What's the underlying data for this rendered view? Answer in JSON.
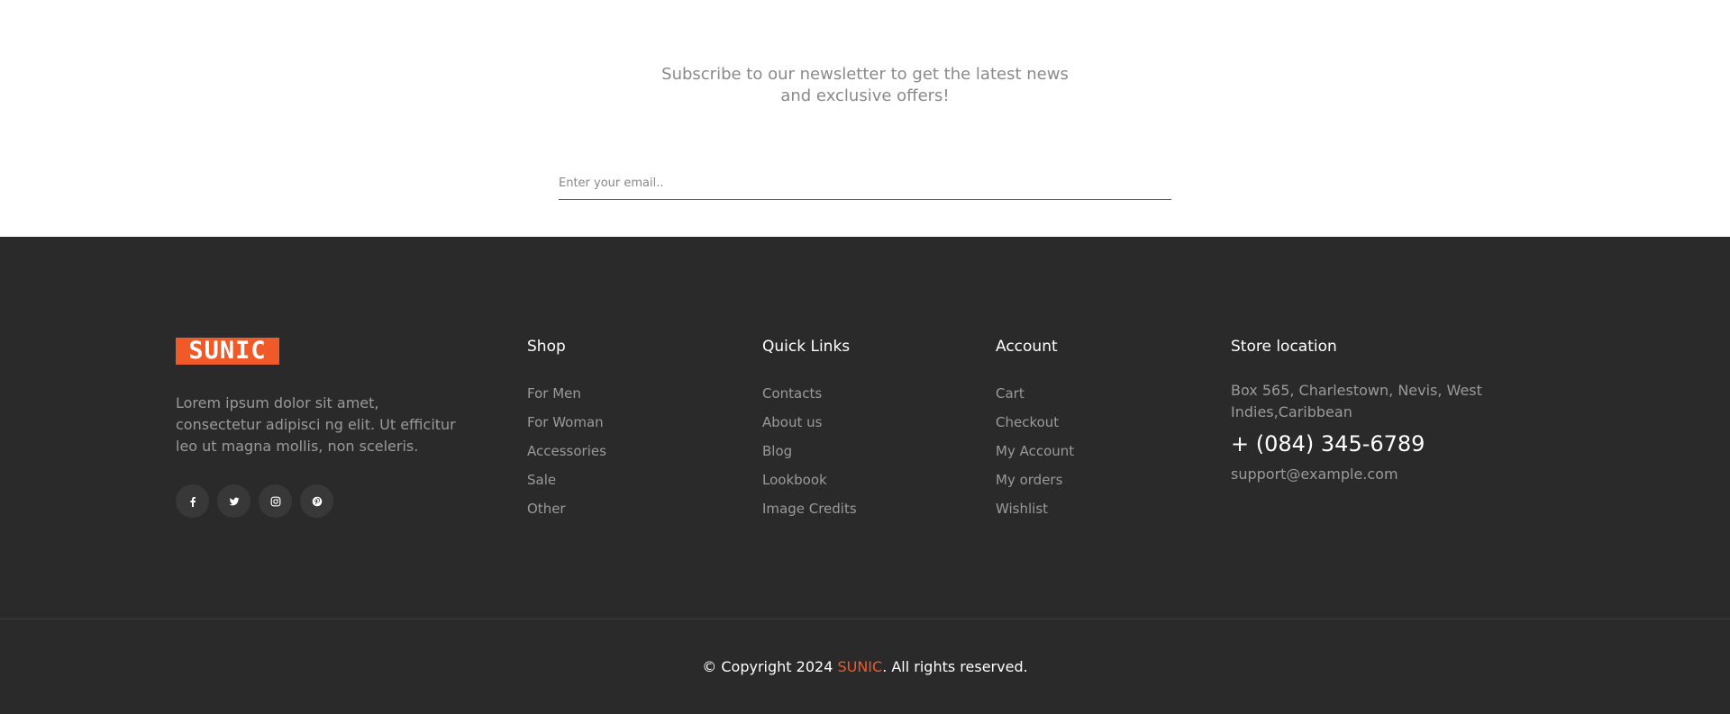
{
  "newsletter": {
    "line1": "Subscribe to our newsletter to get the latest news",
    "line2": "and exclusive offers!",
    "email_placeholder": "Enter your email.."
  },
  "footer": {
    "logo_text": "SUNIC",
    "about": "Lorem ipsum dolor sit amet, consectetur adipisci ng elit. Ut efficitur leo ut magna mollis, non sceleris.",
    "socials": [
      {
        "icon": "facebook-icon"
      },
      {
        "icon": "twitter-icon"
      },
      {
        "icon": "instagram-icon"
      },
      {
        "icon": "pinterest-icon"
      }
    ],
    "shop": {
      "title": "Shop",
      "items": [
        "For Men",
        "For Woman",
        "Accessories",
        "Sale",
        "Other"
      ]
    },
    "quick_links": {
      "title": "Quick Links",
      "items": [
        "Contacts",
        "About us",
        "Blog",
        "Lookbook",
        "Image Credits"
      ]
    },
    "account": {
      "title": "Account",
      "items": [
        "Cart",
        "Checkout",
        "My Account",
        "My orders",
        "Wishlist"
      ]
    },
    "store": {
      "title": "Store location",
      "address": "Box 565, Charlestown, Nevis, West Indies,Caribbean",
      "phone": "+ (084) 345-6789",
      "email": "support@example.com"
    },
    "copyright": {
      "prefix": "© Copyright 2024 ",
      "brand": "SUNIC",
      "suffix": ". All rights reserved."
    }
  },
  "colors": {
    "accent": "#f05a28",
    "footer_bg": "#2a2a2a",
    "muted_text": "#9a9a9a"
  }
}
